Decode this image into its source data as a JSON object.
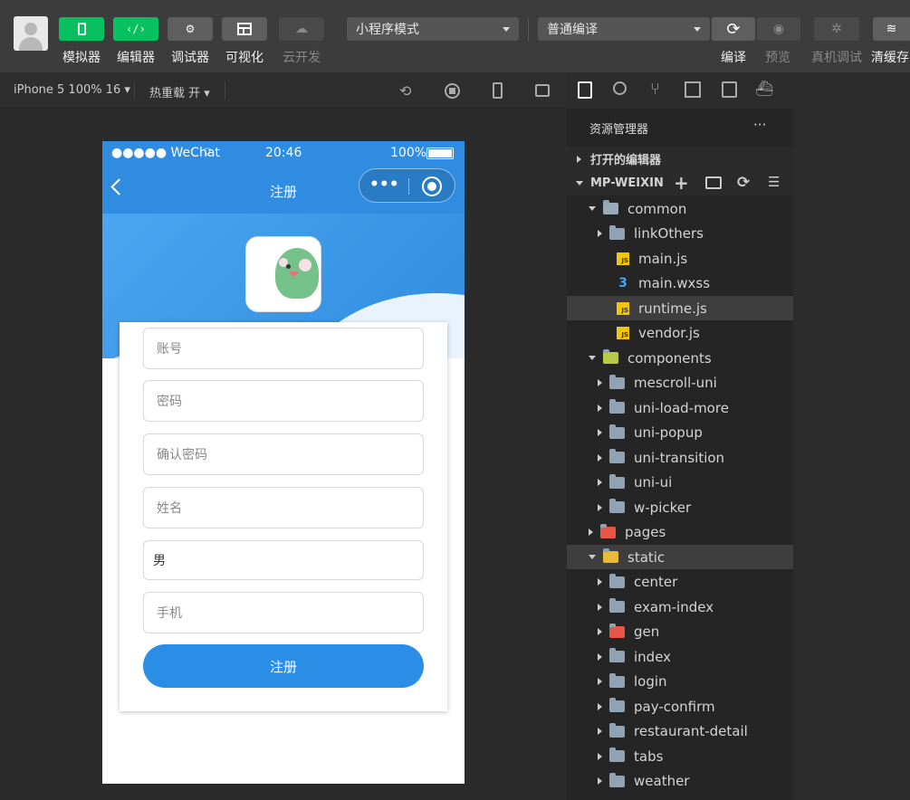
{
  "toolbar": {
    "simulator": "模拟器",
    "editor": "编辑器",
    "debugger": "调试器",
    "visual": "可视化",
    "cloud": "云开发",
    "mode_select": "小程序模式",
    "compile_select": "普通编译",
    "compile": "编译",
    "preview": "预览",
    "real_debug": "真机调试",
    "clear_cache": "清缓存"
  },
  "subbar": {
    "device": "iPhone 5 100% 16 ▾",
    "hot_reload": "热重载 开 ▾"
  },
  "phone": {
    "carrier": "●●●●● WeChat",
    "time": "20:46",
    "battery": "100%",
    "title": "注册",
    "fields": [
      {
        "placeholder": "账号",
        "value": ""
      },
      {
        "placeholder": "密码",
        "value": ""
      },
      {
        "placeholder": "确认密码",
        "value": ""
      },
      {
        "placeholder": "姓名",
        "value": ""
      },
      {
        "placeholder": "",
        "value": "男"
      },
      {
        "placeholder": "手机",
        "value": ""
      }
    ],
    "register_button": "注册"
  },
  "explorer": {
    "title": "资源管理器",
    "more": "···",
    "open_editors": "打开的编辑器",
    "project": "MP-WEIXIN",
    "tree": [
      {
        "label": "common",
        "type": "folder-open",
        "depth": 1
      },
      {
        "label": "linkOthers",
        "type": "folder",
        "depth": 2
      },
      {
        "label": "main.js",
        "type": "js",
        "depth": 2
      },
      {
        "label": "main.wxss",
        "type": "css",
        "depth": 2
      },
      {
        "label": "runtime.js",
        "type": "js",
        "depth": 2,
        "selected": true
      },
      {
        "label": "vendor.js",
        "type": "js",
        "depth": 2
      },
      {
        "label": "components",
        "type": "folder-open-special",
        "depth": 1
      },
      {
        "label": "mescroll-uni",
        "type": "folder",
        "depth": 2
      },
      {
        "label": "uni-load-more",
        "type": "folder",
        "depth": 2
      },
      {
        "label": "uni-popup",
        "type": "folder",
        "depth": 2
      },
      {
        "label": "uni-transition",
        "type": "folder",
        "depth": 2
      },
      {
        "label": "uni-ui",
        "type": "folder",
        "depth": 2
      },
      {
        "label": "w-picker",
        "type": "folder",
        "depth": 2
      },
      {
        "label": "pages",
        "type": "folder-red",
        "depth": 1
      },
      {
        "label": "static",
        "type": "folder-open-yellow",
        "depth": 1,
        "selected": true
      },
      {
        "label": "center",
        "type": "folder",
        "depth": 2
      },
      {
        "label": "exam-index",
        "type": "folder",
        "depth": 2
      },
      {
        "label": "gen",
        "type": "folder-red",
        "depth": 2
      },
      {
        "label": "index",
        "type": "folder",
        "depth": 2
      },
      {
        "label": "login",
        "type": "folder",
        "depth": 2
      },
      {
        "label": "pay-confirm",
        "type": "folder",
        "depth": 2
      },
      {
        "label": "restaurant-detail",
        "type": "folder",
        "depth": 2
      },
      {
        "label": "tabs",
        "type": "folder",
        "depth": 2
      },
      {
        "label": "weather",
        "type": "folder",
        "depth": 2
      }
    ]
  },
  "colors": {
    "accent_green": "#07c160",
    "phone_blue": "#2f8ce0",
    "button_blue": "#2b8ee6"
  }
}
